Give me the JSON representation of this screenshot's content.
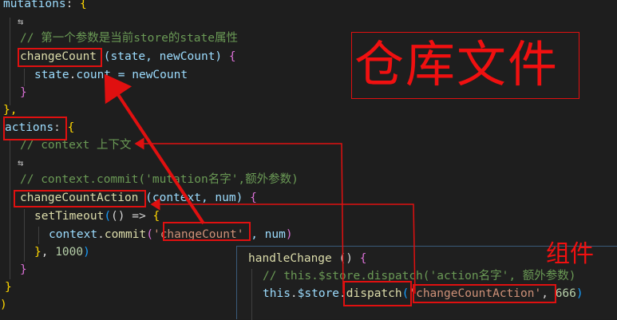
{
  "store_code": {
    "l1": {
      "name": "mutations",
      "punct": ": ",
      "brace": "{"
    },
    "l2": {
      "icon": "cursor-icon"
    },
    "l3": {
      "comment": "// 第一个参数是当前store的state属性"
    },
    "l4": {
      "fn": "changeCount",
      "params": " (state, newCount) ",
      "brace": "{"
    },
    "l5": {
      "obj": "state",
      "dot": ".",
      "prop": "count",
      "rest": " = newCount"
    },
    "l6": {
      "brace": "}"
    },
    "l7": {
      "brace": "},"
    },
    "l8": {
      "name": "actions",
      "punct": ": ",
      "brace": "{"
    },
    "l9": {
      "comment": "// context 上下文"
    },
    "l10": {
      "icon": "cursor-icon"
    },
    "l11": {
      "comment": "// context.commit('mutation名字',额外参数)"
    },
    "l12": {
      "fn": "changeCountAction",
      "params": " (context, num) ",
      "brace": "{"
    },
    "l13": {
      "fn": "setTimeout",
      "open": "(",
      "inner": "() => ",
      "brace": "{"
    },
    "l14": {
      "obj": "context",
      "dot": ".",
      "fn": "commit",
      "open": "(",
      "str": "'changeCount'",
      "rest": " , num",
      "close": ")"
    },
    "l15": {
      "brace": "}",
      "rest": ", ",
      "num": "1000",
      "close": ")"
    },
    "l16": {
      "brace": "}"
    },
    "l17": {
      "brace": "}"
    },
    "l18": {
      "brace": ")"
    }
  },
  "component_code": {
    "l1": {
      "fn": "handleChange",
      "params": " () ",
      "brace": "{"
    },
    "l2": {
      "comment": "// this.$store.dispatch('action名字', 额外参数)"
    },
    "l3": {
      "kw": "this",
      "dot1": ".",
      "obj": "$store",
      "dot2": ".",
      "fn": "dispatch",
      "open": "(",
      "str": "'changeCountAction'",
      "rest": ", ",
      "num": "666",
      "close": ")"
    }
  },
  "annotations": {
    "store_label": "仓库文件",
    "component_label": "组件"
  },
  "colors": {
    "annotation": "#e01010",
    "background": "#1e1e1e"
  }
}
